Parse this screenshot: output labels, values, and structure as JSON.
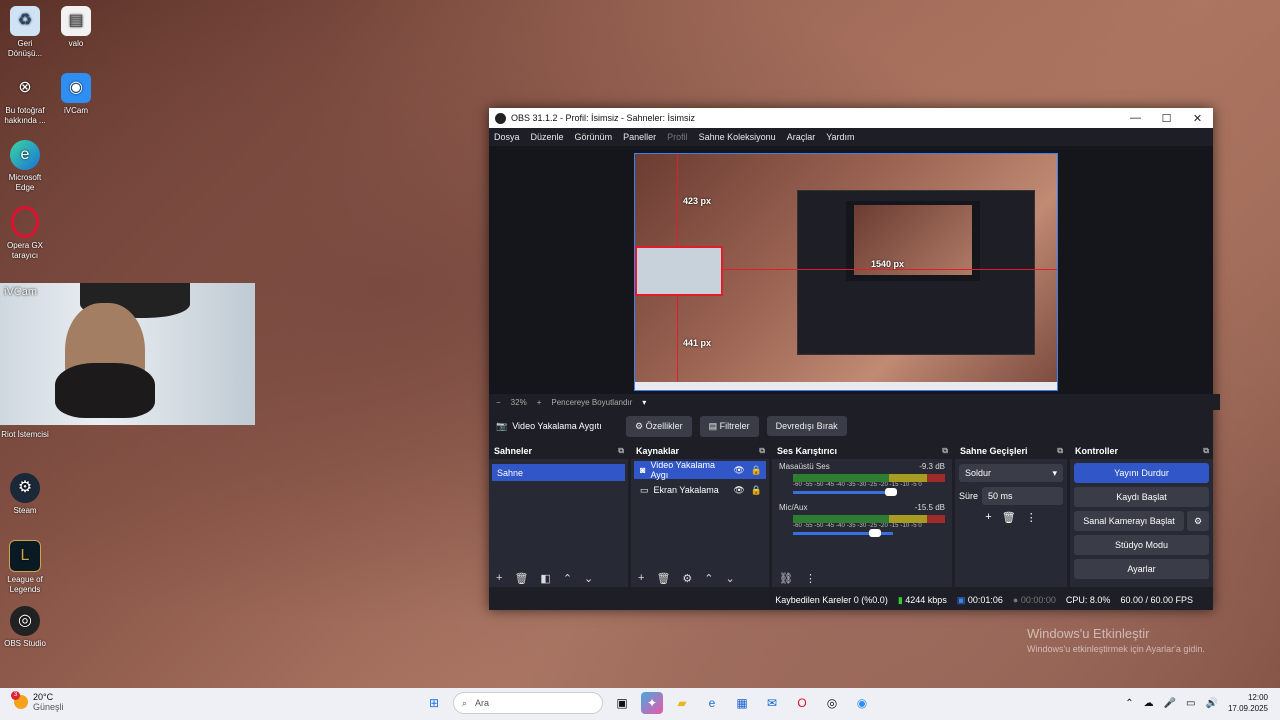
{
  "desktop": {
    "icons": [
      {
        "label": "Geri Dönüşü...",
        "icon": "recycle-bin-icon"
      },
      {
        "label": "valo",
        "icon": "document-icon"
      },
      {
        "label": "Bu fotoğraf hakkında ...",
        "icon": "photo-info-icon"
      },
      {
        "label": "iVCam",
        "icon": "ivcam-icon"
      },
      {
        "label": "Microsoft Edge",
        "icon": "edge-icon"
      },
      {
        "label": "Opera GX tarayıcı",
        "icon": "opera-gx-icon"
      },
      {
        "label": "Riot İstemcisi",
        "icon": "riot-icon"
      },
      {
        "label": "Steam",
        "icon": "steam-icon"
      },
      {
        "label": "League of Legends",
        "icon": "league-icon"
      },
      {
        "label": "OBS Studio",
        "icon": "obs-icon"
      }
    ],
    "ivcam_title": "iVCam",
    "activate": {
      "line1": "Windows'u Etkinleştir",
      "line2": "Windows'u etkinleştirmek için Ayarlar'a gidin."
    }
  },
  "obs": {
    "title": "OBS 31.1.2 - Profil: İsimsiz - Sahneler: İsimsiz",
    "menu": [
      "Dosya",
      "Düzenle",
      "Görünüm",
      "Paneller",
      "Profil",
      "Sahne Koleksiyonu",
      "Araçlar",
      "Yardım"
    ],
    "preview": {
      "label_top": "423 px",
      "label_right": "1540 px",
      "label_bottom": "441 px"
    },
    "zoom": {
      "minus": "−",
      "value": "32%",
      "plus": "+",
      "fit": "Pencereye Boyutlandır"
    },
    "source_toolbar": {
      "selected_source": "Video Yakalama Aygıtı",
      "properties": "Özellikler",
      "filters": "Filtreler",
      "deactivate": "Devredışı Bırak"
    },
    "scenes": {
      "title": "Sahneler",
      "items": [
        "Sahne"
      ]
    },
    "sources": {
      "title": "Kaynaklar",
      "items": [
        "Video Yakalama Aygı",
        "Ekran Yakalama"
      ]
    },
    "mixer": {
      "title": "Ses Karıştırıcı",
      "scale": "-60 -55 -50 -45 -40 -35 -30 -25 -20 -15 -10 -5 0",
      "channels": [
        {
          "name": "Masaüstü Ses",
          "db": "-9.3 dB"
        },
        {
          "name": "Mic/Aux",
          "db": "-15.5 dB"
        }
      ]
    },
    "transitions": {
      "title": "Sahne Geçişleri",
      "type": "Soldur",
      "duration_label": "Süre",
      "duration": "50 ms"
    },
    "controls": {
      "title": "Kontroller",
      "stop_stream": "Yayını Durdur",
      "start_record": "Kaydı Başlat",
      "virtual_cam": "Sanal Kamerayı Başlat",
      "studio_mode": "Stüdyo Modu",
      "settings": "Ayarlar"
    },
    "status": {
      "dropped": "Kaybedilen Kareler 0 (%0.0)",
      "bitrate": "4244 kbps",
      "stream_time": "00:01:06",
      "record_time": "00:00:00",
      "cpu": "CPU: 8.0%",
      "fps": "60.00 / 60.00 FPS"
    }
  },
  "taskbar": {
    "weather_temp": "20°C",
    "weather_desc": "Güneşli",
    "weather_badge": "3",
    "search_placeholder": "Ara",
    "time": "12:00",
    "date": "17.09.2025"
  }
}
